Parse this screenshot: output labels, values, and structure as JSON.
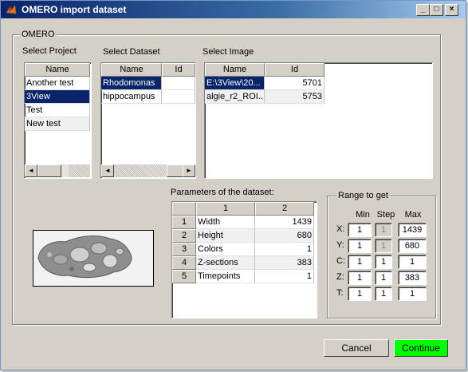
{
  "window": {
    "title": "OMERO import dataset",
    "minimize": "_",
    "maximize": "□",
    "close": "×"
  },
  "group_label": "OMERO",
  "project": {
    "label": "Select Project",
    "header": "Name",
    "items": [
      "Another test",
      "3View",
      "Test",
      "New test"
    ]
  },
  "dataset": {
    "label": "Select Dataset",
    "headers": [
      "Name",
      "Id"
    ],
    "items": [
      "Rhodomonas",
      "hippocampus"
    ]
  },
  "image": {
    "label": "Select Image",
    "headers": [
      "Name",
      "Id"
    ],
    "rows": [
      [
        "E:\\3View\\20...",
        "5701"
      ],
      [
        "algie_r2_ROI...",
        "5753"
      ]
    ]
  },
  "params": {
    "label": "Parameters of the dataset:",
    "headers": [
      "1",
      "2"
    ],
    "rows": [
      [
        "1",
        "Width",
        "1439"
      ],
      [
        "2",
        "Height",
        "680"
      ],
      [
        "3",
        "Colors",
        "1"
      ],
      [
        "4",
        "Z-sections",
        "383"
      ],
      [
        "5",
        "Timepoints",
        "1"
      ]
    ]
  },
  "range": {
    "label": "Range to get",
    "headers": [
      "Min",
      "Step",
      "Max"
    ],
    "rows": [
      [
        "X:",
        "1",
        "1",
        "1439"
      ],
      [
        "Y:",
        "1",
        "1",
        "680"
      ],
      [
        "C:",
        "1",
        "1",
        "1"
      ],
      [
        "Z:",
        "1",
        "1",
        "383"
      ],
      [
        "T:",
        "1",
        "1",
        "1"
      ]
    ]
  },
  "buttons": {
    "cancel": "Cancel",
    "continue": "Continue"
  },
  "colors": {
    "selection": "#0a246a",
    "continue_button": "#00ff00",
    "titlebar": "#0a246a"
  },
  "icons": {
    "scroll_left": "◄",
    "scroll_right": "►"
  }
}
